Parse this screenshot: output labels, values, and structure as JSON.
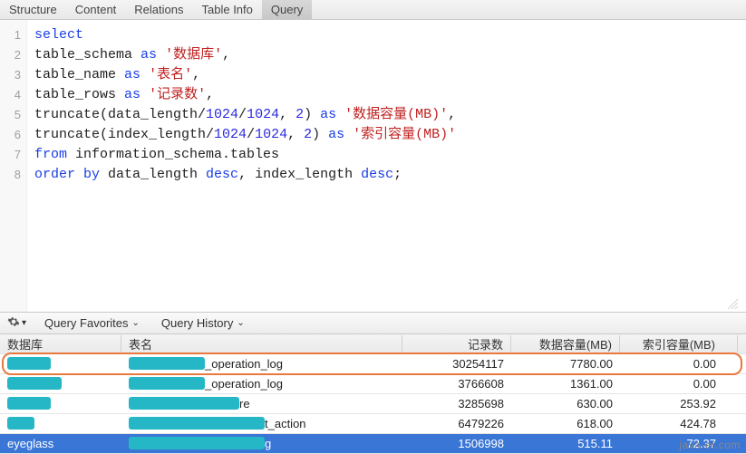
{
  "tabs": {
    "items": [
      "Structure",
      "Content",
      "Relations",
      "Table Info",
      "Query"
    ],
    "active_index": 4
  },
  "editor": {
    "line_numbers": [
      1,
      2,
      3,
      4,
      5,
      6,
      7,
      8
    ],
    "tokens": [
      [
        [
          "kw",
          "select"
        ]
      ],
      [
        [
          "",
          "table_schema "
        ],
        [
          "kw",
          "as"
        ],
        [
          "",
          " "
        ],
        [
          "str",
          "'数据库'"
        ],
        [
          "",
          ","
        ]
      ],
      [
        [
          "",
          "table_name "
        ],
        [
          "kw",
          "as"
        ],
        [
          "",
          " "
        ],
        [
          "str",
          "'表名'"
        ],
        [
          "",
          ","
        ]
      ],
      [
        [
          "",
          "table_rows "
        ],
        [
          "kw",
          "as"
        ],
        [
          "",
          " "
        ],
        [
          "str",
          "'记录数'"
        ],
        [
          "",
          ","
        ]
      ],
      [
        [
          "",
          "truncate(data_length/"
        ],
        [
          "num",
          "1024"
        ],
        [
          "",
          "/"
        ],
        [
          "num",
          "1024"
        ],
        [
          "",
          ", "
        ],
        [
          "num",
          "2"
        ],
        [
          "",
          ") "
        ],
        [
          "kw",
          "as"
        ],
        [
          "",
          " "
        ],
        [
          "str",
          "'数据容量(MB)'"
        ],
        [
          "",
          ","
        ]
      ],
      [
        [
          "",
          "truncate(index_length/"
        ],
        [
          "num",
          "1024"
        ],
        [
          "",
          "/"
        ],
        [
          "num",
          "1024"
        ],
        [
          "",
          ", "
        ],
        [
          "num",
          "2"
        ],
        [
          "",
          ") "
        ],
        [
          "kw",
          "as"
        ],
        [
          "",
          " "
        ],
        [
          "str",
          "'索引容量(MB)'"
        ]
      ],
      [
        [
          "kw",
          "from"
        ],
        [
          "",
          " information_schema.tables"
        ]
      ],
      [
        [
          "kw",
          "order by"
        ],
        [
          "",
          " data_length "
        ],
        [
          "kw",
          "desc"
        ],
        [
          "",
          ", index_length "
        ],
        [
          "kw",
          "desc"
        ],
        [
          "",
          ";"
        ]
      ]
    ]
  },
  "toolbar": {
    "favorites": "Query Favorites",
    "history": "Query History"
  },
  "results": {
    "headers": [
      "数据库",
      "表名",
      "记录数",
      "数据容量(MB)",
      "索引容量(MB)"
    ],
    "rows": [
      {
        "db_mask_w": 48,
        "tbl_prefix_w": 84,
        "tbl_suffix": "_operation_log",
        "n": "30254117",
        "d": "7780.00",
        "i": "0.00",
        "highlighted": true
      },
      {
        "db_mask_w": 60,
        "tbl_prefix_w": 84,
        "tbl_suffix": "_operation_log",
        "n": "3766608",
        "d": "1361.00",
        "i": "0.00"
      },
      {
        "db_mask_w": 48,
        "tbl_prefix_w": 122,
        "tbl_suffix": "re",
        "n": "3285698",
        "d": "630.00",
        "i": "253.92"
      },
      {
        "db_mask_w": 30,
        "tbl_prefix_w": 150,
        "tbl_suffix": "t_action",
        "n": "6479226",
        "d": "618.00",
        "i": "424.78"
      },
      {
        "db_visible": "eyeglass",
        "tbl_prefix_w": 150,
        "tbl_suffix": "g",
        "n": "1506998",
        "d": "515.11",
        "i": "72.37",
        "selected": true
      }
    ]
  },
  "watermark": "java-er.com"
}
